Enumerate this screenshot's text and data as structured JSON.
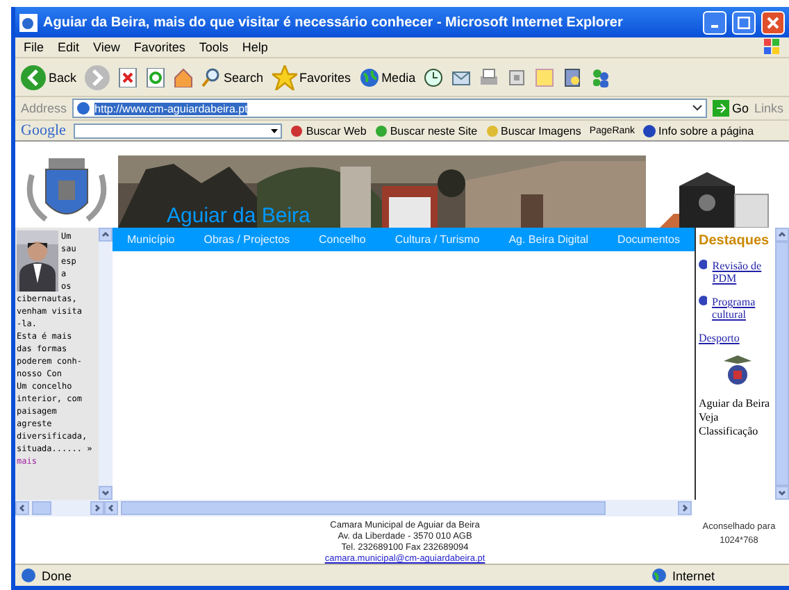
{
  "window": {
    "title": "Aguiar da Beira, mais do que visitar é necessário conhecer - Microsoft Internet Explorer"
  },
  "menu": [
    "File",
    "Edit",
    "View",
    "Favorites",
    "Tools",
    "Help"
  ],
  "toolbar": [
    {
      "kind": "back",
      "label": "Back"
    },
    {
      "kind": "forward"
    },
    {
      "kind": "stop"
    },
    {
      "kind": "refresh"
    },
    {
      "kind": "home"
    },
    {
      "kind": "search",
      "label": "Search"
    },
    {
      "kind": "favorites",
      "label": "Favorites"
    },
    {
      "kind": "media",
      "label": "Media"
    },
    {
      "kind": "history"
    },
    {
      "kind": "mail"
    },
    {
      "kind": "print"
    },
    {
      "kind": "edit"
    },
    {
      "kind": "note"
    },
    {
      "kind": "research"
    },
    {
      "kind": "messenger"
    }
  ],
  "address": {
    "label": "Address",
    "value": "http://www.cm-aguiardabeira.pt",
    "go": "Go",
    "links": "Links"
  },
  "google_bar": {
    "logo": "Google",
    "buttons": [
      "Buscar Web",
      "Buscar neste Site",
      "Buscar Imagens"
    ],
    "pagerank": "PageRank",
    "info": "Info sobre a página"
  },
  "site": {
    "banner_title": "Aguiar da Beira",
    "nav": [
      "Município",
      "Obras / Projectos",
      "Concelho",
      "Cultura / Turismo",
      "Ag. Beira Digital",
      "Documentos"
    ],
    "intro_side": [
      "Um",
      "sau",
      "esp",
      "a",
      "os"
    ],
    "intro_lines": [
      "cibernautas,",
      "venham visita",
      "-la.",
      "Esta é mais",
      "das formas",
      "poderem conh-",
      "nosso Con",
      "Um concelho",
      "interior, com",
      "paisagem",
      "agreste",
      "diversificada,",
      "situada...... »"
    ],
    "more_link": "mais",
    "highlights": {
      "title": "Destaques",
      "items": [
        "Revisão de PDM",
        "Programa cultural"
      ],
      "sport_link": "Desporto",
      "classification": "Aguiar da Beira Veja Classificação"
    },
    "footer": {
      "lines": [
        "Camara Municipal de Aguiar da Beira",
        "Av. da Liberdade - 3570 010 AGB",
        "Tel. 232689100 Fax 232689094"
      ],
      "email": "camara.municipal@cm-aguiardabeira.pt",
      "resolution": "Aconselhado para 1024*768"
    }
  },
  "status_bar": {
    "text": "Done",
    "zone": "Internet"
  }
}
